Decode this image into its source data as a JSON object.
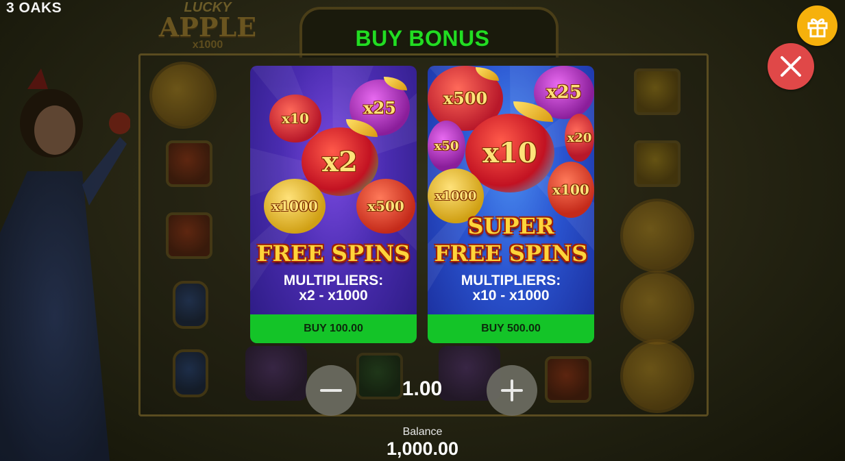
{
  "header": {
    "brand": "3 OAKS",
    "game_logo_line1": "LUCKY",
    "game_logo_line2": "APPLE",
    "game_logo_line3": "x1000"
  },
  "modal": {
    "title": "BUY BONUS",
    "options": [
      {
        "name_line1": "FREE SPINS",
        "name_line2": "",
        "multipliers_label": "MULTIPLIERS:",
        "multipliers_range": "x2 - x1000",
        "buy_label": "BUY 100.00",
        "apple_labels": [
          "x10",
          "x25",
          "x2",
          "x1000",
          "x500"
        ]
      },
      {
        "name_line1": "SUPER",
        "name_line2": "FREE SPINS",
        "multipliers_label": "MULTIPLIERS:",
        "multipliers_range": "x10 - x1000",
        "buy_label": "BUY 500.00",
        "apple_labels": [
          "x500",
          "x25",
          "x50",
          "x10",
          "x20",
          "x1000",
          "x100"
        ]
      }
    ],
    "stake": "1.00",
    "decrease_icon": "minus-icon",
    "increase_icon": "plus-icon"
  },
  "balance": {
    "label": "Balance",
    "value": "1,000.00"
  },
  "controls": {
    "close_icon": "close-icon",
    "gift_icon": "gift-icon"
  },
  "colors": {
    "title": "#22dd22",
    "buy_button": "#14c428",
    "close_button": "#e04848",
    "gift_button": "#f6b10c",
    "bonus_text": "#ffd43a"
  }
}
